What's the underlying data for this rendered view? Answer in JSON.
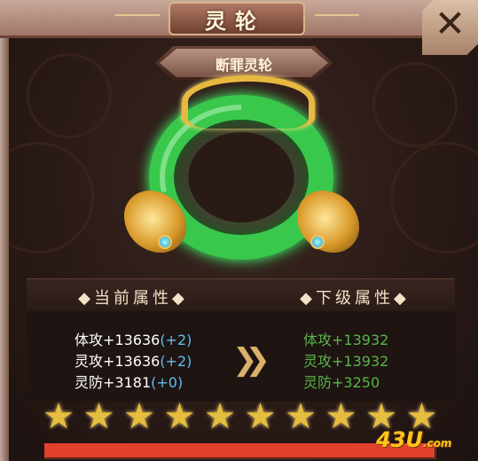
{
  "window": {
    "title": "灵轮",
    "close_icon": "close-x-icon"
  },
  "item": {
    "name": "断罪灵轮"
  },
  "stats": {
    "current_header": "◆当前属性◆",
    "next_header": "◆下级属性◆",
    "current": [
      {
        "label": "体攻+13636",
        "bonus": "(+2)"
      },
      {
        "label": "灵攻+13636",
        "bonus": "(+2)"
      },
      {
        "label": "灵防+3181",
        "bonus": "(+0)"
      }
    ],
    "next": [
      "体攻+13932",
      "灵攻+13932",
      "灵防+3250"
    ]
  },
  "stars": {
    "count": 10,
    "filled": 10,
    "icon": "star-icon"
  },
  "progress": {
    "fraction": 1.0,
    "color": "#e2412c"
  },
  "watermark": {
    "main": "43U",
    "suffix": ".com"
  },
  "colors": {
    "bonus": "#5dbdf0",
    "next_stat": "#59b54a",
    "star": "#e6bd3e"
  }
}
